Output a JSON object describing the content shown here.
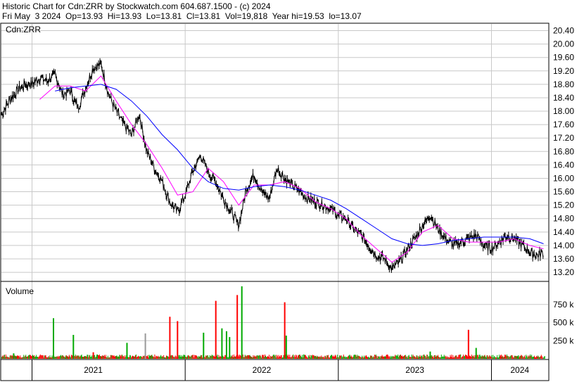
{
  "header": {
    "line1": "Historic Chart for Cdn:ZRR by Stockwatch.com 604.687.1500 - (c) 2024",
    "line2": "Fri May  3 2024  Op=13.93  Hi=13.93  Lo=13.81  Cl=13.81  Vol=19,818  Year hi=19.53  lo=13.07"
  },
  "colors": {
    "price": "#000000",
    "ma_short": "#ff00ff",
    "ma_long": "#0000ff",
    "vol_up": "#00aa00",
    "vol_down": "#ff0000",
    "vol_flat": "#999999",
    "grid": "#c8c8c8"
  },
  "chart_data": [
    {
      "type": "candlestick",
      "title": "Cdn:ZRR",
      "y_ticks": [
        "20.40",
        "20.00",
        "19.60",
        "19.20",
        "18.80",
        "18.40",
        "18.00",
        "17.60",
        "17.20",
        "16.80",
        "16.40",
        "16.00",
        "15.60",
        "15.20",
        "14.80",
        "14.40",
        "14.00",
        "13.60",
        "13.20"
      ],
      "ylim": [
        12.95,
        20.6
      ],
      "x_ticks": [
        "2021",
        "2022",
        "2023",
        "2024"
      ],
      "x_range": [
        2020.8,
        2024.37
      ],
      "grid": true,
      "series": [
        {
          "name": "price",
          "kind": "ohlc",
          "x": [
            2020.8,
            2020.85,
            2020.9,
            2020.95,
            2021.0,
            2021.05,
            2021.1,
            2021.15,
            2021.2,
            2021.25,
            2021.3,
            2021.35,
            2021.4,
            2021.45,
            2021.5,
            2021.55,
            2021.6,
            2021.65,
            2021.7,
            2021.75,
            2021.8,
            2021.85,
            2021.9,
            2021.95,
            2022.0,
            2022.05,
            2022.1,
            2022.15,
            2022.2,
            2022.25,
            2022.3,
            2022.35,
            2022.4,
            2022.45,
            2022.5,
            2022.55,
            2022.6,
            2022.65,
            2022.7,
            2022.75,
            2022.8,
            2022.85,
            2022.9,
            2022.95,
            2023.0,
            2023.05,
            2023.1,
            2023.15,
            2023.2,
            2023.25,
            2023.3,
            2023.35,
            2023.4,
            2023.45,
            2023.5,
            2023.55,
            2023.6,
            2023.65,
            2023.7,
            2023.75,
            2023.8,
            2023.85,
            2023.9,
            2023.95,
            2024.0,
            2024.05,
            2024.1,
            2024.15,
            2024.2,
            2024.25,
            2024.3,
            2024.34
          ],
          "close": [
            17.9,
            18.3,
            18.6,
            18.8,
            18.8,
            19.0,
            18.9,
            19.1,
            18.5,
            18.6,
            18.1,
            18.7,
            19.3,
            19.4,
            18.5,
            18.0,
            17.6,
            17.3,
            17.9,
            16.8,
            16.3,
            15.9,
            15.3,
            15.0,
            15.5,
            16.2,
            16.7,
            16.2,
            15.9,
            15.4,
            15.0,
            14.6,
            15.7,
            16.1,
            15.6,
            15.4,
            16.3,
            16.0,
            15.8,
            15.6,
            15.4,
            15.3,
            15.2,
            15.1,
            14.9,
            14.8,
            14.5,
            14.3,
            14.0,
            13.7,
            13.6,
            13.3,
            13.5,
            13.9,
            14.2,
            14.6,
            14.9,
            14.5,
            14.2,
            14.0,
            14.1,
            14.2,
            14.3,
            14.0,
            13.9,
            14.1,
            14.3,
            14.2,
            14.0,
            13.8,
            13.7,
            13.8
          ]
        },
        {
          "name": "ma_short",
          "kind": "line",
          "x": [
            2021.05,
            2021.15,
            2021.25,
            2021.35,
            2021.45,
            2021.55,
            2021.65,
            2021.75,
            2021.85,
            2021.95,
            2022.05,
            2022.15,
            2022.25,
            2022.35,
            2022.45,
            2022.55,
            2022.65,
            2022.75,
            2022.85,
            2022.95,
            2023.05,
            2023.15,
            2023.25,
            2023.35,
            2023.45,
            2023.55,
            2023.65,
            2023.75,
            2023.85,
            2023.95,
            2024.05,
            2024.15,
            2024.25,
            2024.34
          ],
          "values": [
            18.35,
            18.75,
            18.75,
            18.6,
            19.05,
            18.3,
            17.6,
            17.0,
            16.3,
            15.5,
            15.6,
            16.3,
            15.9,
            15.2,
            15.8,
            15.8,
            15.9,
            15.7,
            15.3,
            15.1,
            14.8,
            14.3,
            13.9,
            13.5,
            13.8,
            14.4,
            14.6,
            14.2,
            14.1,
            14.1,
            14.1,
            14.2,
            14.0,
            13.9
          ]
        },
        {
          "name": "ma_long",
          "kind": "line",
          "x": [
            2021.15,
            2021.25,
            2021.35,
            2021.45,
            2021.55,
            2021.65,
            2021.75,
            2021.85,
            2021.95,
            2022.05,
            2022.15,
            2022.25,
            2022.35,
            2022.45,
            2022.55,
            2022.65,
            2022.75,
            2022.85,
            2022.95,
            2023.05,
            2023.15,
            2023.25,
            2023.35,
            2023.45,
            2023.55,
            2023.65,
            2023.75,
            2023.85,
            2023.95,
            2024.05,
            2024.15,
            2024.25,
            2024.34
          ],
          "values": [
            18.6,
            18.7,
            18.75,
            18.8,
            18.65,
            18.3,
            17.85,
            17.3,
            16.85,
            16.3,
            15.9,
            15.7,
            15.65,
            15.75,
            15.8,
            15.75,
            15.65,
            15.5,
            15.35,
            15.1,
            14.8,
            14.5,
            14.2,
            14.05,
            14.0,
            14.05,
            14.15,
            14.2,
            14.25,
            14.25,
            14.25,
            14.2,
            14.05
          ]
        }
      ]
    },
    {
      "type": "bar",
      "title": "Volume",
      "y_ticks": [
        "750 k",
        "500 k",
        "250 k"
      ],
      "y_tick_values": [
        750000,
        500000,
        250000
      ],
      "ylim": [
        0,
        1000000
      ],
      "x_range": [
        2020.8,
        2024.37
      ],
      "spikes": {
        "x": [
          2020.88,
          2021.14,
          2021.27,
          2021.4,
          2021.62,
          2021.74,
          2021.9,
          2021.95,
          2022.12,
          2022.2,
          2022.24,
          2022.27,
          2022.29,
          2022.34,
          2022.37,
          2022.65,
          2022.66,
          2023.6,
          2023.85,
          2023.9
        ],
        "values": [
          75000,
          560000,
          330000,
          90000,
          220000,
          350000,
          580000,
          520000,
          360000,
          800000,
          420000,
          380000,
          300000,
          880000,
          1000000,
          780000,
          320000,
          100000,
          400000,
          150000
        ],
        "dir": [
          "up",
          "up",
          "up",
          "down",
          "up",
          "flat",
          "down",
          "down",
          "up",
          "down",
          "up",
          "up",
          "up",
          "down",
          "up",
          "down",
          "up",
          "up",
          "down",
          "up"
        ]
      }
    }
  ]
}
